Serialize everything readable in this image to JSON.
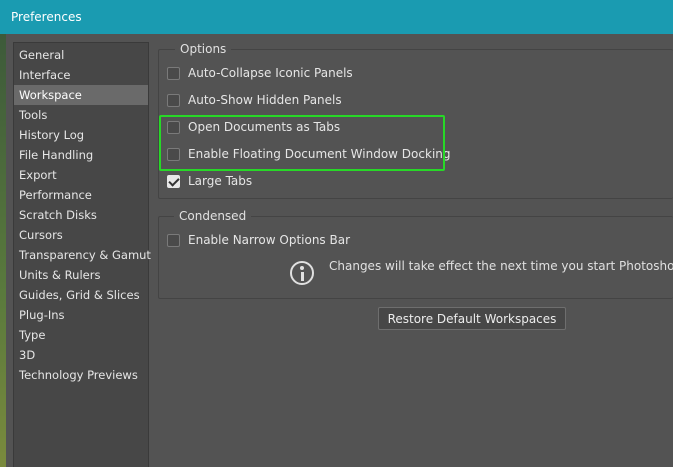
{
  "window": {
    "title": "Preferences"
  },
  "sidebar": {
    "items": [
      {
        "label": "General"
      },
      {
        "label": "Interface"
      },
      {
        "label": "Workspace",
        "selected": true
      },
      {
        "label": "Tools"
      },
      {
        "label": "History Log"
      },
      {
        "label": "File Handling"
      },
      {
        "label": "Export"
      },
      {
        "label": "Performance"
      },
      {
        "label": "Scratch Disks"
      },
      {
        "label": "Cursors"
      },
      {
        "label": "Transparency & Gamut"
      },
      {
        "label": "Units & Rulers"
      },
      {
        "label": "Guides, Grid & Slices"
      },
      {
        "label": "Plug-Ins"
      },
      {
        "label": "Type"
      },
      {
        "label": "3D"
      },
      {
        "label": "Technology Previews"
      }
    ]
  },
  "options": {
    "title": "Options",
    "items": [
      {
        "label": "Auto-Collapse Iconic Panels",
        "checked": false
      },
      {
        "label": "Auto-Show Hidden Panels",
        "checked": false
      },
      {
        "label": "Open Documents as Tabs",
        "checked": false
      },
      {
        "label": "Enable Floating Document Window Docking",
        "checked": false
      },
      {
        "label": "Large Tabs",
        "checked": true
      }
    ]
  },
  "condensed": {
    "title": "Condensed",
    "items": [
      {
        "label": "Enable Narrow Options Bar",
        "checked": false
      }
    ]
  },
  "notice": {
    "icon": "info-icon",
    "text": "Changes will take effect the next time you start Photoshop."
  },
  "restore_button": {
    "label": "Restore Default Workspaces"
  },
  "colors": {
    "titlebar": "#1a9bb1",
    "background": "#535353",
    "highlight": "#27d827"
  }
}
